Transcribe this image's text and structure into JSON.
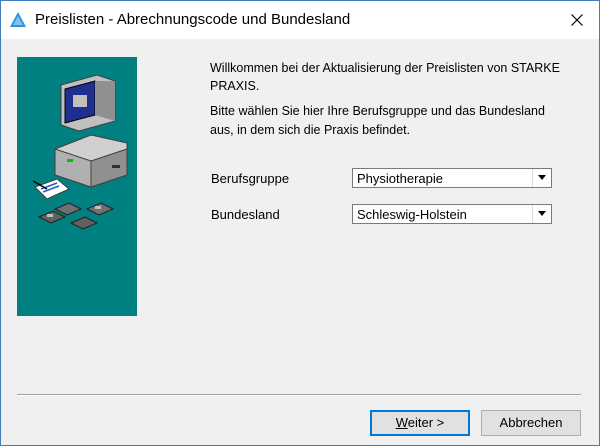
{
  "window": {
    "title": "Preislisten - Abrechnungscode und Bundesland"
  },
  "content": {
    "welcome_text": "Willkommen bei der Aktualisierung der Preislisten von STARKE PRAXIS.",
    "instruction_text": "Bitte wählen Sie hier Ihre Berufsgruppe und das Bundesland aus, in dem sich die Praxis befindet."
  },
  "form": {
    "berufsgruppe": {
      "label": "Berufsgruppe",
      "value": "Physiotherapie"
    },
    "bundesland": {
      "label": "Bundesland",
      "value": "Schleswig-Holstein"
    }
  },
  "buttons": {
    "next_mnemonic": "W",
    "next_rest": "eiter >",
    "cancel": "Abbrechen"
  },
  "colors": {
    "side_panel": "#008080",
    "accent": "#0078d7"
  },
  "icons": {
    "app": "triangle-app-icon",
    "close": "close-icon",
    "illustration": "computer-illustration-icon",
    "dropdown": "chevron-down-icon"
  }
}
